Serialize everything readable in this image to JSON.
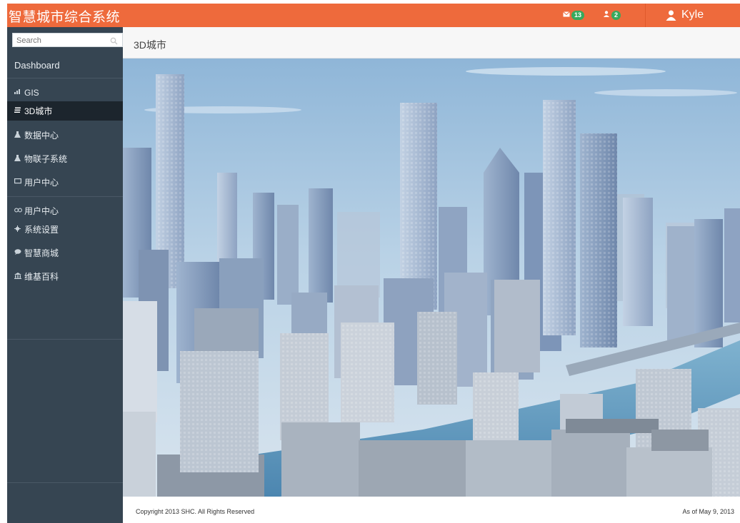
{
  "header": {
    "brand": "智慧城市综合系统",
    "messages_count": "13",
    "tasks_count": "2",
    "user_name": "Kyle",
    "accent": "#ee6a3c"
  },
  "sidebar": {
    "search_placeholder": "Search",
    "dashboard_label": "Dashboard",
    "items": [
      {
        "label": "GIS",
        "icon": "chart-icon"
      },
      {
        "label": "3D城市",
        "icon": "list-icon",
        "active": true
      },
      {
        "label": "数据中心",
        "icon": "flask-icon"
      },
      {
        "label": "物联子系统",
        "icon": "flask-icon"
      },
      {
        "label": "用户中心",
        "icon": "monitor-icon"
      },
      {
        "label": "用户中心",
        "icon": "link-icon"
      },
      {
        "label": "系统设置",
        "icon": "gear-icon"
      },
      {
        "label": "智慧商城",
        "icon": "chat-icon"
      },
      {
        "label": "维基百科",
        "icon": "bank-icon"
      }
    ]
  },
  "content": {
    "title": "3D城市"
  },
  "footer": {
    "copyright": "Copyright 2013 SHC. All Rights Reserved",
    "as_of": "As of May 9, 2013"
  }
}
